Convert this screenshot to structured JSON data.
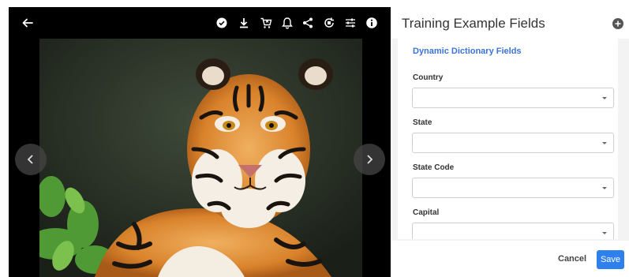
{
  "viewer": {
    "toolbar": {
      "icons": [
        "back-arrow-icon",
        "check-circle-icon",
        "download-icon",
        "cart-remove-icon",
        "bell-icon",
        "share-icon",
        "rotate-icon",
        "tune-icon",
        "info-icon"
      ]
    },
    "photo_subject": "tiger",
    "nav": {
      "prev_icon": "chevron-left-icon",
      "next_icon": "chevron-right-icon"
    }
  },
  "panel": {
    "title": "Training Example Fields",
    "add_icon": "plus-circle-icon",
    "section_title": "Dynamic Dictionary Fields",
    "fields": [
      {
        "label": "Country",
        "value": ""
      },
      {
        "label": "State",
        "value": ""
      },
      {
        "label": "State Code",
        "value": ""
      },
      {
        "label": "Capital",
        "value": ""
      }
    ],
    "footer": {
      "cancel_label": "Cancel",
      "save_label": "Save"
    }
  },
  "colors": {
    "accent": "#2f80ed",
    "section_title": "#3b74d6",
    "viewer_bg": "#000000",
    "panel_bg": "#f3f3f3"
  }
}
